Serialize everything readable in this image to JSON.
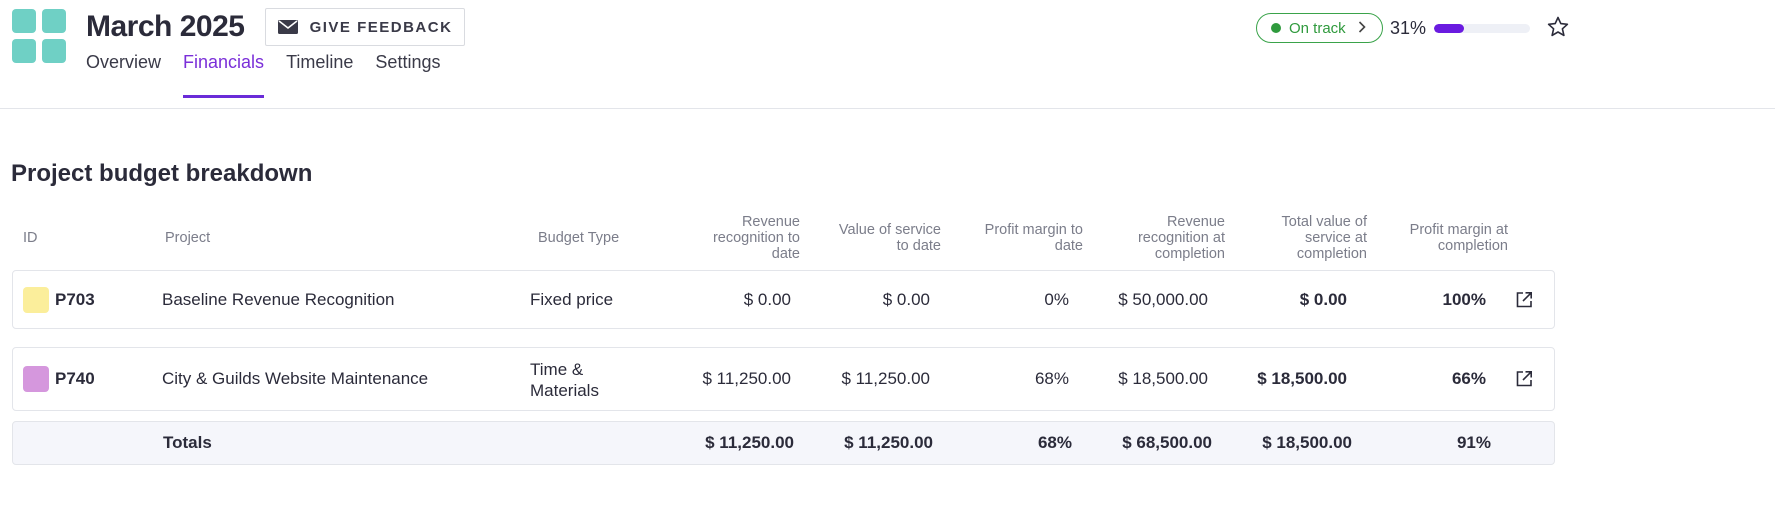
{
  "header": {
    "title": "March 2025",
    "feedback_label": "GIVE FEEDBACK",
    "tabs": [
      {
        "label": "Overview"
      },
      {
        "label": "Financials",
        "active": true
      },
      {
        "label": "Timeline"
      },
      {
        "label": "Settings"
      }
    ],
    "status": "On track",
    "progress_label": "31%",
    "progress_value": 0.31,
    "accent_color": "#6a1be0",
    "status_color": "#2f9a3d",
    "logo_color": "#6fd0c5"
  },
  "section": {
    "title": "Project budget breakdown"
  },
  "table": {
    "columns": {
      "id": "ID",
      "project": "Project",
      "budget_type": "Budget Type",
      "rev_to_date": [
        "Revenue",
        "recognition to",
        "date"
      ],
      "value_to_date": [
        "Value of service",
        "to date"
      ],
      "margin_to_date": [
        "Profit margin to",
        "date"
      ],
      "rev_completion": [
        "Revenue",
        "recognition at",
        "completion"
      ],
      "value_completion": [
        "Total value of",
        "service at",
        "completion"
      ],
      "margin_completion": [
        "Profit margin at",
        "completion"
      ]
    },
    "rows": [
      {
        "id": "P703",
        "color": "#fbee9b",
        "project": "Baseline Revenue Recognition",
        "budget_type": [
          "Fixed price"
        ],
        "rev_to_date": "$ 0.00",
        "value_to_date": "$ 0.00",
        "margin_to_date": "0%",
        "rev_completion": "$ 50,000.00",
        "value_completion": "$ 0.00",
        "margin_completion": "100%"
      },
      {
        "id": "P740",
        "color": "#d597dd",
        "project": "City & Guilds Website Maintenance",
        "budget_type": [
          "Time &",
          "Materials"
        ],
        "rev_to_date": "$ 11,250.00",
        "value_to_date": "$ 11,250.00",
        "margin_to_date": "68%",
        "rev_completion": "$ 18,500.00",
        "value_completion": "$ 18,500.00",
        "margin_completion": "66%"
      }
    ],
    "totals": {
      "label": "Totals",
      "rev_to_date": "$ 11,250.00",
      "value_to_date": "$ 11,250.00",
      "margin_to_date": "68%",
      "rev_completion": "$ 68,500.00",
      "value_completion": "$ 18,500.00",
      "margin_completion": "91%"
    }
  }
}
